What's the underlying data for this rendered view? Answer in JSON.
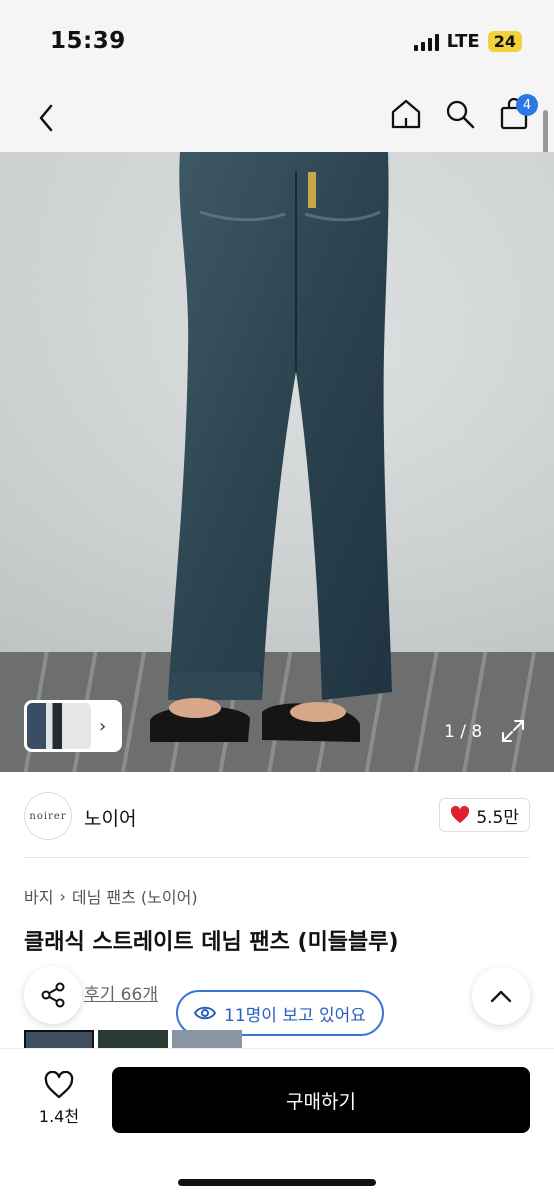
{
  "status_bar": {
    "time": "15:39",
    "network": "LTE",
    "battery": "24"
  },
  "nav": {
    "cart_count": "4"
  },
  "gallery": {
    "counter": "1 / 8"
  },
  "seller": {
    "logo_text": "noirer",
    "name": "노이어",
    "likes": "5.5만"
  },
  "breadcrumb": {
    "category": "바지",
    "subcategory": "데님 팬츠 (노이어)"
  },
  "product": {
    "title": "클래식 스트레이트 데님 팬츠 (미들블루)"
  },
  "reviews": {
    "label": "후기 66개"
  },
  "viewers": {
    "label": "11명이 보고 있어요"
  },
  "bottom": {
    "wish_count": "1.4천",
    "buy_label": "구매하기"
  },
  "colors": {
    "accent": "#2a78e4",
    "like": "#e0202e",
    "buy_bg": "#000000"
  }
}
